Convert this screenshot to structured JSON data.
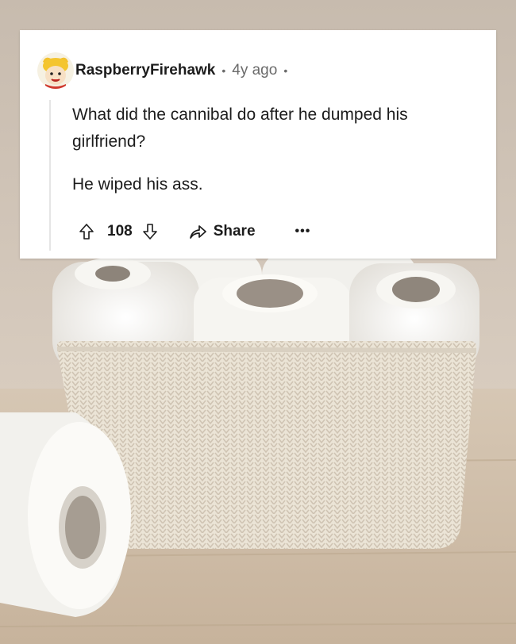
{
  "comment": {
    "username": "RaspberryFirehawk",
    "time": "4y ago",
    "body_lines": [
      "What did the cannibal do after he dumped his girlfriend?",
      "He wiped his ass."
    ],
    "score": "108",
    "share_label": "Share",
    "more_label": "•••"
  },
  "icons": {
    "avatar": "avatar-icon",
    "upvote": "upvote-arrow-icon",
    "downvote": "downvote-arrow-icon",
    "share": "share-icon",
    "more": "more-dots-icon"
  },
  "colors": {
    "card": "#ffffff",
    "text": "#1c1c1c",
    "meta": "#6b6b6b"
  }
}
